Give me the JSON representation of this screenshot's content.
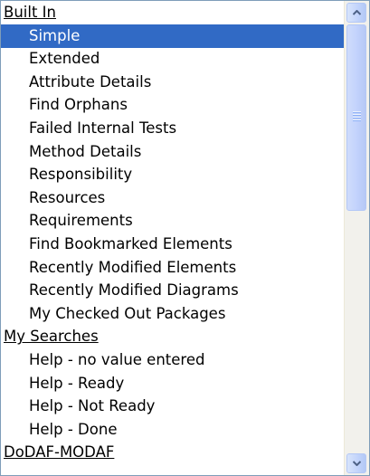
{
  "list": {
    "rows": [
      {
        "label": "Built In",
        "kind": "group",
        "selected": false
      },
      {
        "label": "Simple",
        "kind": "item",
        "selected": true
      },
      {
        "label": "Extended",
        "kind": "item",
        "selected": false
      },
      {
        "label": "Attribute Details",
        "kind": "item",
        "selected": false
      },
      {
        "label": "Find Orphans",
        "kind": "item",
        "selected": false
      },
      {
        "label": "Failed Internal Tests",
        "kind": "item",
        "selected": false
      },
      {
        "label": "Method Details",
        "kind": "item",
        "selected": false
      },
      {
        "label": "Responsibility",
        "kind": "item",
        "selected": false
      },
      {
        "label": "Resources",
        "kind": "item",
        "selected": false
      },
      {
        "label": "Requirements",
        "kind": "item",
        "selected": false
      },
      {
        "label": "Find Bookmarked Elements",
        "kind": "item",
        "selected": false
      },
      {
        "label": "Recently Modified Elements",
        "kind": "item",
        "selected": false
      },
      {
        "label": "Recently Modified Diagrams",
        "kind": "item",
        "selected": false
      },
      {
        "label": "My Checked Out Packages",
        "kind": "item",
        "selected": false
      },
      {
        "label": "My Searches",
        "kind": "group",
        "selected": false
      },
      {
        "label": "Help - no value entered",
        "kind": "item",
        "selected": false
      },
      {
        "label": "Help - Ready",
        "kind": "item",
        "selected": false
      },
      {
        "label": "Help - Not Ready",
        "kind": "item",
        "selected": false
      },
      {
        "label": "Help - Done",
        "kind": "item",
        "selected": false
      },
      {
        "label": "DoDAF-MODAF",
        "kind": "group",
        "selected": false
      }
    ]
  },
  "scrollbar": {
    "up_icon": "arrow-up-icon",
    "down_icon": "arrow-down-icon",
    "thumb_icon": "grip-icon",
    "scroll_position": 0
  },
  "colors": {
    "selection": "#316ac5",
    "selection_text": "#ffffff",
    "border": "#7f9db9",
    "scrollbar_accent": "#4d6185"
  }
}
